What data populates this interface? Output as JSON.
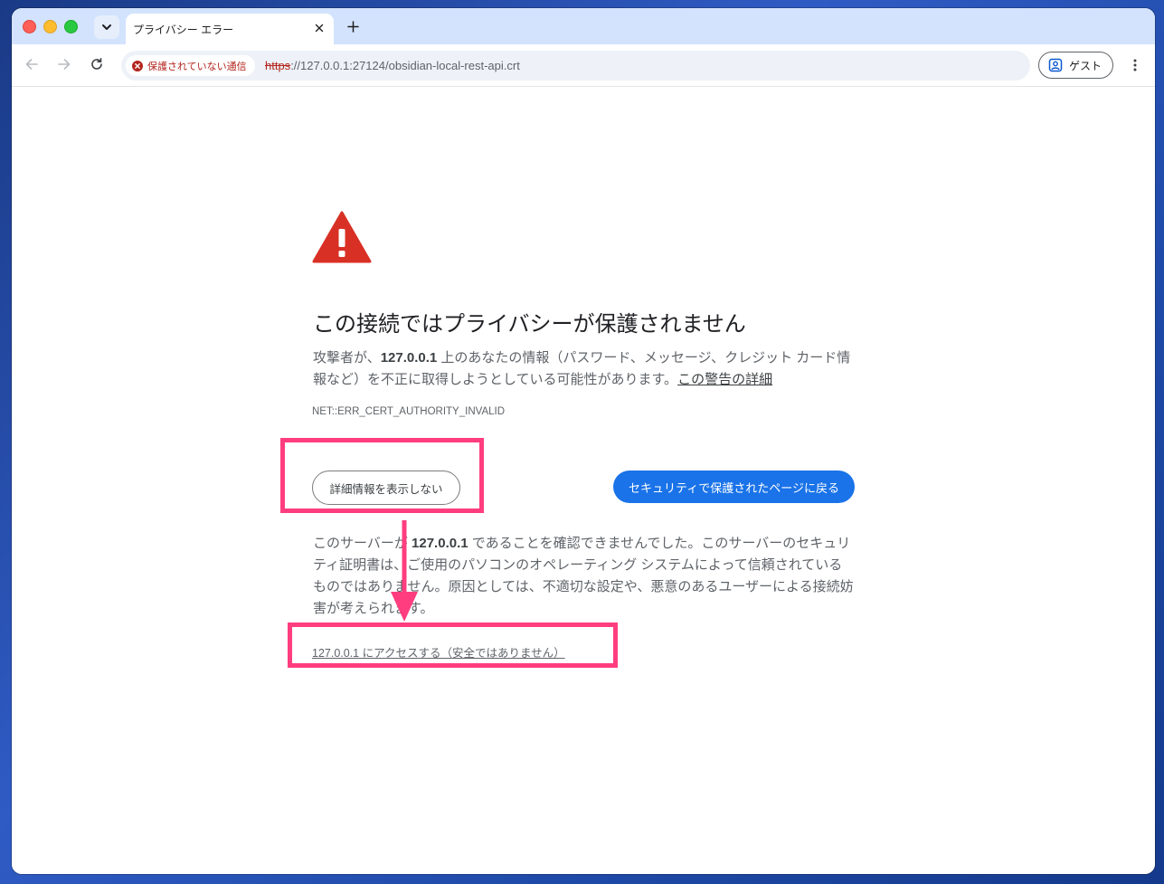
{
  "tab": {
    "title": "プライバシー エラー"
  },
  "omnibox": {
    "security_chip": "保護されていない通信",
    "url_scheme": "https",
    "url_rest": "://127.0.0.1:27124/obsidian-local-rest-api.crt"
  },
  "profile": {
    "label": "ゲスト"
  },
  "page": {
    "heading": "この接続ではプライバシーが保護されません",
    "intro_1": "攻撃者が、",
    "intro_host": "127.0.0.1",
    "intro_2": " 上のあなたの情報（パスワード、メッセージ、クレジット カード情報など）を不正に取得しようとしている可能性があります。",
    "learn_more": "この警告の詳細",
    "error_code": "NET::ERR_CERT_AUTHORITY_INVALID",
    "hide_details": "詳細情報を表示しない",
    "back_to_safety": "セキュリティで保護されたページに戻る",
    "details_1": "このサーバーが ",
    "details_host": "127.0.0.1",
    "details_2": " であることを確認できませんでした。このサーバーのセキュリティ証明書は、ご使用のパソコンのオペレーティング システムによって信頼されているものではありません。原因としては、不適切な設定や、悪意のあるユーザーによる接続妨害が考えられます。",
    "proceed_link": "127.0.0.1 にアクセスする（安全ではありません）"
  },
  "colors": {
    "annotation": "#ff3d7f",
    "warning": "#d93025",
    "primary_button": "#1a73e8",
    "insecure": "#b3261e"
  }
}
